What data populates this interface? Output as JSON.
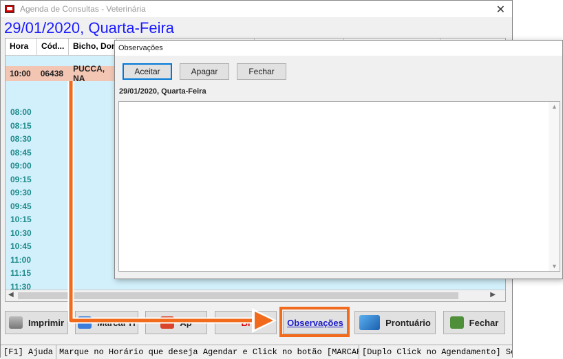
{
  "window": {
    "title": "Agenda de Consultas - Veterinária"
  },
  "header": {
    "date": "29/01/2020, Quarta-Feira"
  },
  "grid": {
    "columns": [
      "Hora",
      "Cód...",
      "Bicho, Don"
    ],
    "appointment": {
      "time": "10:00",
      "code": "06438",
      "name": "PUCCA, NA"
    },
    "times": [
      "08:00",
      "08:15",
      "08:30",
      "08:45",
      "09:00",
      "09:15",
      "09:30",
      "09:45",
      "10:15",
      "10:30",
      "10:45",
      "11:00",
      "11:15",
      "11:30"
    ]
  },
  "toolbar": {
    "imprimir": "Imprimir",
    "marcar": "Marcar H",
    "apagar": "Ap",
    "bloquear": "Bl",
    "observacoes": "Observações",
    "prontuario": "Prontuário",
    "fechar": "Fechar"
  },
  "statusbar": {
    "help": "[F1] Ajuda",
    "hint": "Marque no Horário que deseja Agendar e Click no botão [MARCAR HORA]",
    "double_click": "[Duplo Click no Agendamento] Serviços"
  },
  "dialog": {
    "title": "Observações",
    "accept": "Aceitar",
    "delete": "Apagar",
    "close": "Fechar",
    "date": "29/01/2020, Quarta-Feira",
    "text": ""
  },
  "colors": {
    "accent": "#f26a1b",
    "date_blue": "#1a1aff",
    "time_teal": "#1c8a8a",
    "grid_bg": "#d2f0fb"
  }
}
